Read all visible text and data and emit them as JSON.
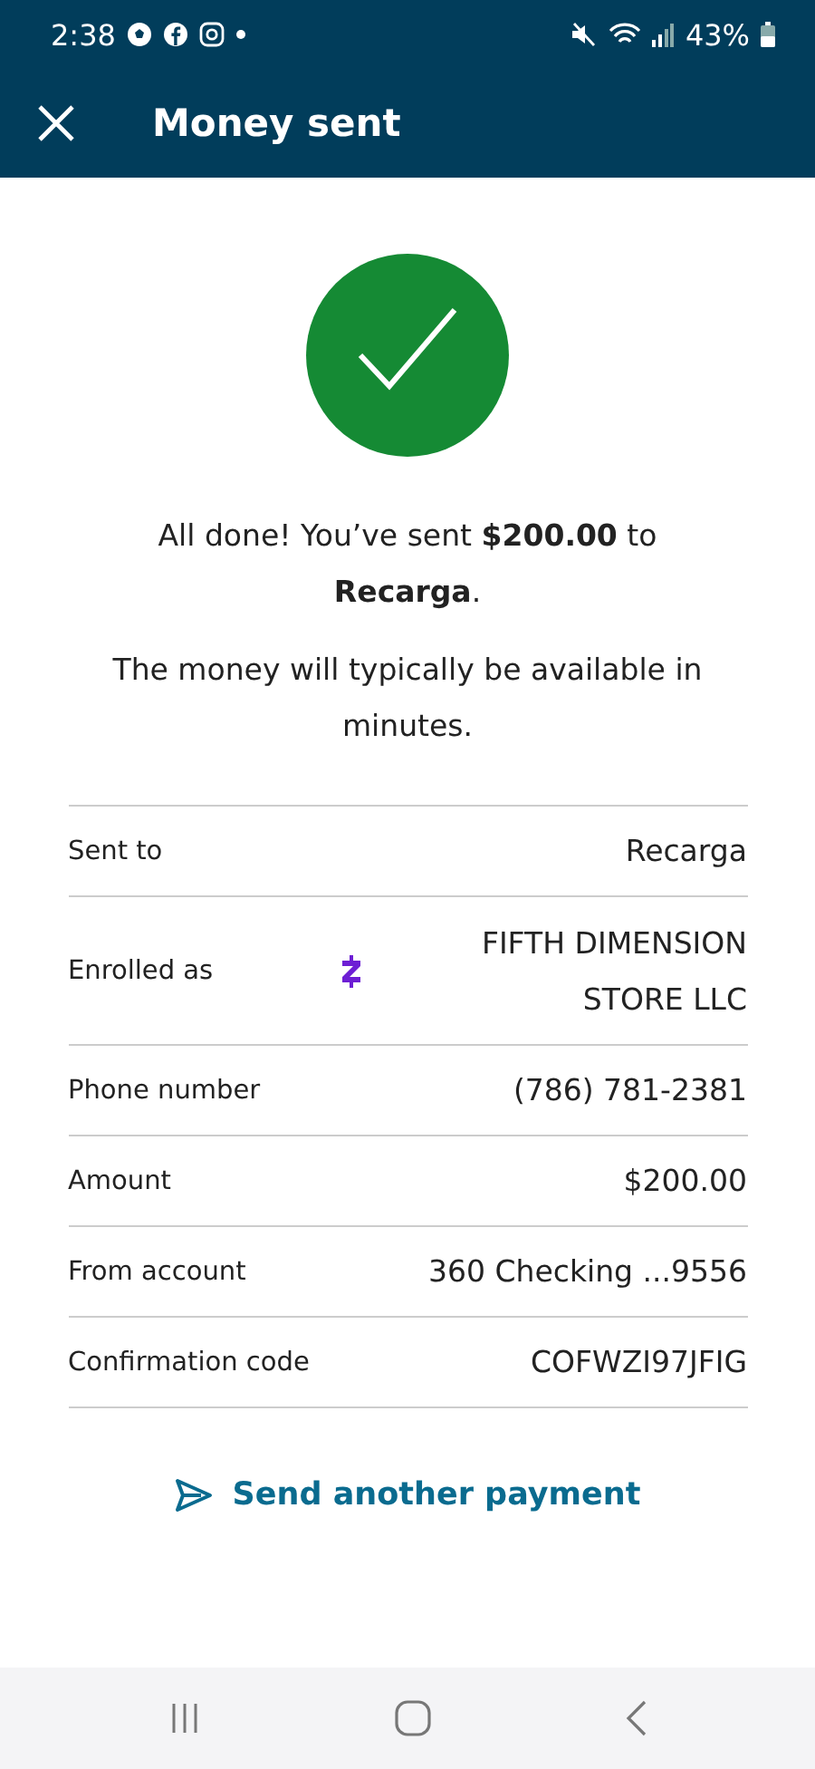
{
  "status_bar": {
    "time": "2:38",
    "battery": "43%"
  },
  "header": {
    "title": "Money sent"
  },
  "message": "All done! You’ve sent **$200.00** to **Recarga**.",
  "note": "The money will typically be available in minutes.",
  "details": [
    {
      "label": "Sent to",
      "value": "Recarga",
      "kind": "plain"
    },
    {
      "label": "Enrolled as",
      "value": "FIFTH DIMENSION STORE LLC",
      "kind": "zelle"
    },
    {
      "label": "Phone number",
      "value": "(786) 781-2381",
      "kind": "plain"
    },
    {
      "label": "Amount",
      "value": "$200.00",
      "kind": "plain"
    },
    {
      "label": "From account",
      "value": "360 Checking ...9556",
      "kind": "plain"
    },
    {
      "label": "Confirmation code",
      "value": "COFWZI97JFIG",
      "kind": "plain"
    }
  ],
  "action": {
    "label": "Send another payment"
  }
}
